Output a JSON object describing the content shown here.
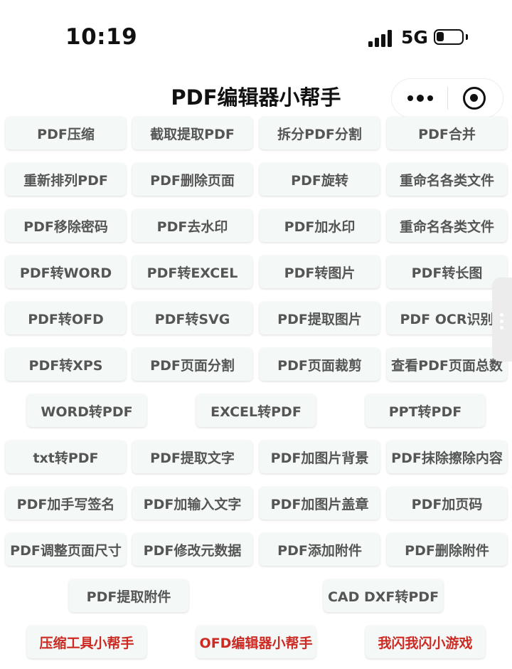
{
  "status_bar": {
    "time": "10:19",
    "network": "5G",
    "battery_level": 0.3
  },
  "nav": {
    "title": "PDF编辑器小帮手",
    "more_icon": "more-dots-icon",
    "close_icon": "target-circle-icon"
  },
  "tools": [
    "PDF压缩",
    "截取提取PDF",
    "拆分PDF分割",
    "PDF合并",
    "重新排列PDF",
    "PDF删除页面",
    "PDF旋转",
    "重命名各类文件",
    "PDF移除密码",
    "PDF去水印",
    "PDF加水印",
    "重命名各类文件",
    "PDF转WORD",
    "PDF转EXCEL",
    "PDF转图片",
    "PDF转长图",
    "PDF转OFD",
    "PDF转SVG",
    "PDF提取图片",
    "PDF OCR识别",
    "PDF转XPS",
    "PDF页面分割",
    "PDF页面裁剪",
    "查看PDF页面总数",
    "WORD转PDF",
    "EXCEL转PDF",
    "PPT转PDF",
    "txt转PDF",
    "PDF提取文字",
    "PDF加图片背景",
    "PDF抹除擦除内容",
    "PDF加手写签名",
    "PDF加输入文字",
    "PDF加图片盖章",
    "PDF加页码",
    "PDF调整页面尺寸",
    "PDF修改元数据",
    "PDF添加附件",
    "PDF删除附件",
    "PDF提取附件",
    "CAD DXF转PDF"
  ],
  "related_apps": [
    "压缩工具小帮手",
    "OFD编辑器小帮手",
    "我闪我闪小游戏"
  ],
  "colors": {
    "button_bg": "#f4f8f6",
    "button_text": "#555555",
    "link_red": "#cc2a22"
  }
}
